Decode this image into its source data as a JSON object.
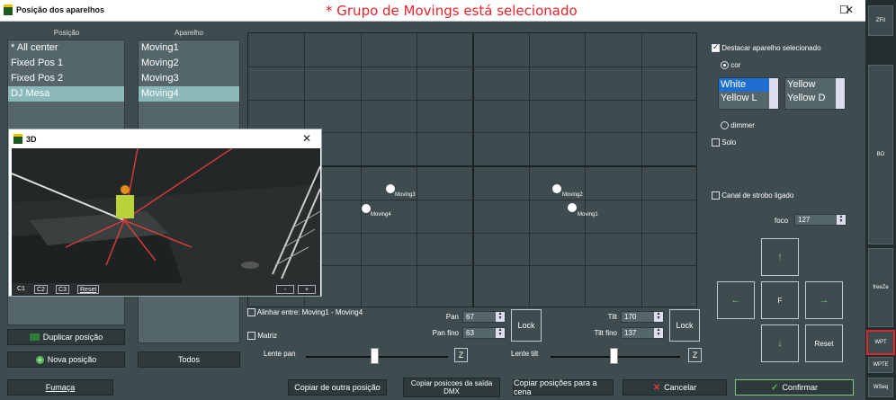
{
  "window": {
    "title": "Posição dos aparelhos",
    "selection_message": "* Grupo de Movings está selecionado"
  },
  "posicao": {
    "header": "Posição",
    "items": [
      "* All center",
      "Fixed Pos 1",
      "Fixed Pos 2",
      "DJ Mesa"
    ],
    "selected_index": 3,
    "duplicate_label": "Duplicar posição",
    "new_label": "Nova posição"
  },
  "aparelho": {
    "header": "Aparelho",
    "items": [
      "Moving1",
      "Moving2",
      "Moving3",
      "Moving4"
    ],
    "selected_index": 3,
    "all_label": "Todos"
  },
  "view3d": {
    "title": "3D",
    "c1": "C1",
    "c2": "C2",
    "c3": "C3",
    "reset": "Reset",
    "minus": "-",
    "plus": "+"
  },
  "grid": {
    "fixtures": [
      "Moving3",
      "Moving4",
      "Moving2",
      "Moving1"
    ]
  },
  "controls": {
    "align_label": "Alinhar entre: Moving1 - Moving4",
    "matrix_label": "Matriz",
    "pan_label": "Pan",
    "pan_value": "67",
    "pan_fine_label": "Pan fino",
    "pan_fine_value": "63",
    "tilt_label": "Tilt",
    "tilt_value": "170",
    "tilt_fine_label": "Tilt fino",
    "tilt_fine_value": "137",
    "lock_label": "Lock",
    "lens_pan_label": "Lente pan",
    "lens_tilt_label": "Lente tilt",
    "z_label": "Z"
  },
  "right": {
    "highlight_label": "Destacar aparelho selecionado",
    "color_label": "cor",
    "colors_left": [
      "White",
      "Yellow L"
    ],
    "colors_right": [
      "Yellow",
      "Yellow D"
    ],
    "dimmer_label": "dimmer",
    "solo_label": "Solo",
    "strobe_label": "Canal de strobo ligado",
    "focus_label": "foco",
    "focus_value": "127",
    "f_label": "F",
    "reset_label": "Reset"
  },
  "bottom": {
    "smoke": "Fumaça",
    "copy_other": "Copiar de outra posição",
    "copy_dmx": "Copiar posicoes da saída DMX",
    "copy_scene": "Copiar posições para a cena",
    "cancel": "Cancelar",
    "confirm": "Confirmar"
  },
  "sidebar": {
    "buttons": [
      "ZFit",
      "BO",
      "freeZe",
      "WPT",
      "WPTE",
      "WSeq"
    ]
  }
}
